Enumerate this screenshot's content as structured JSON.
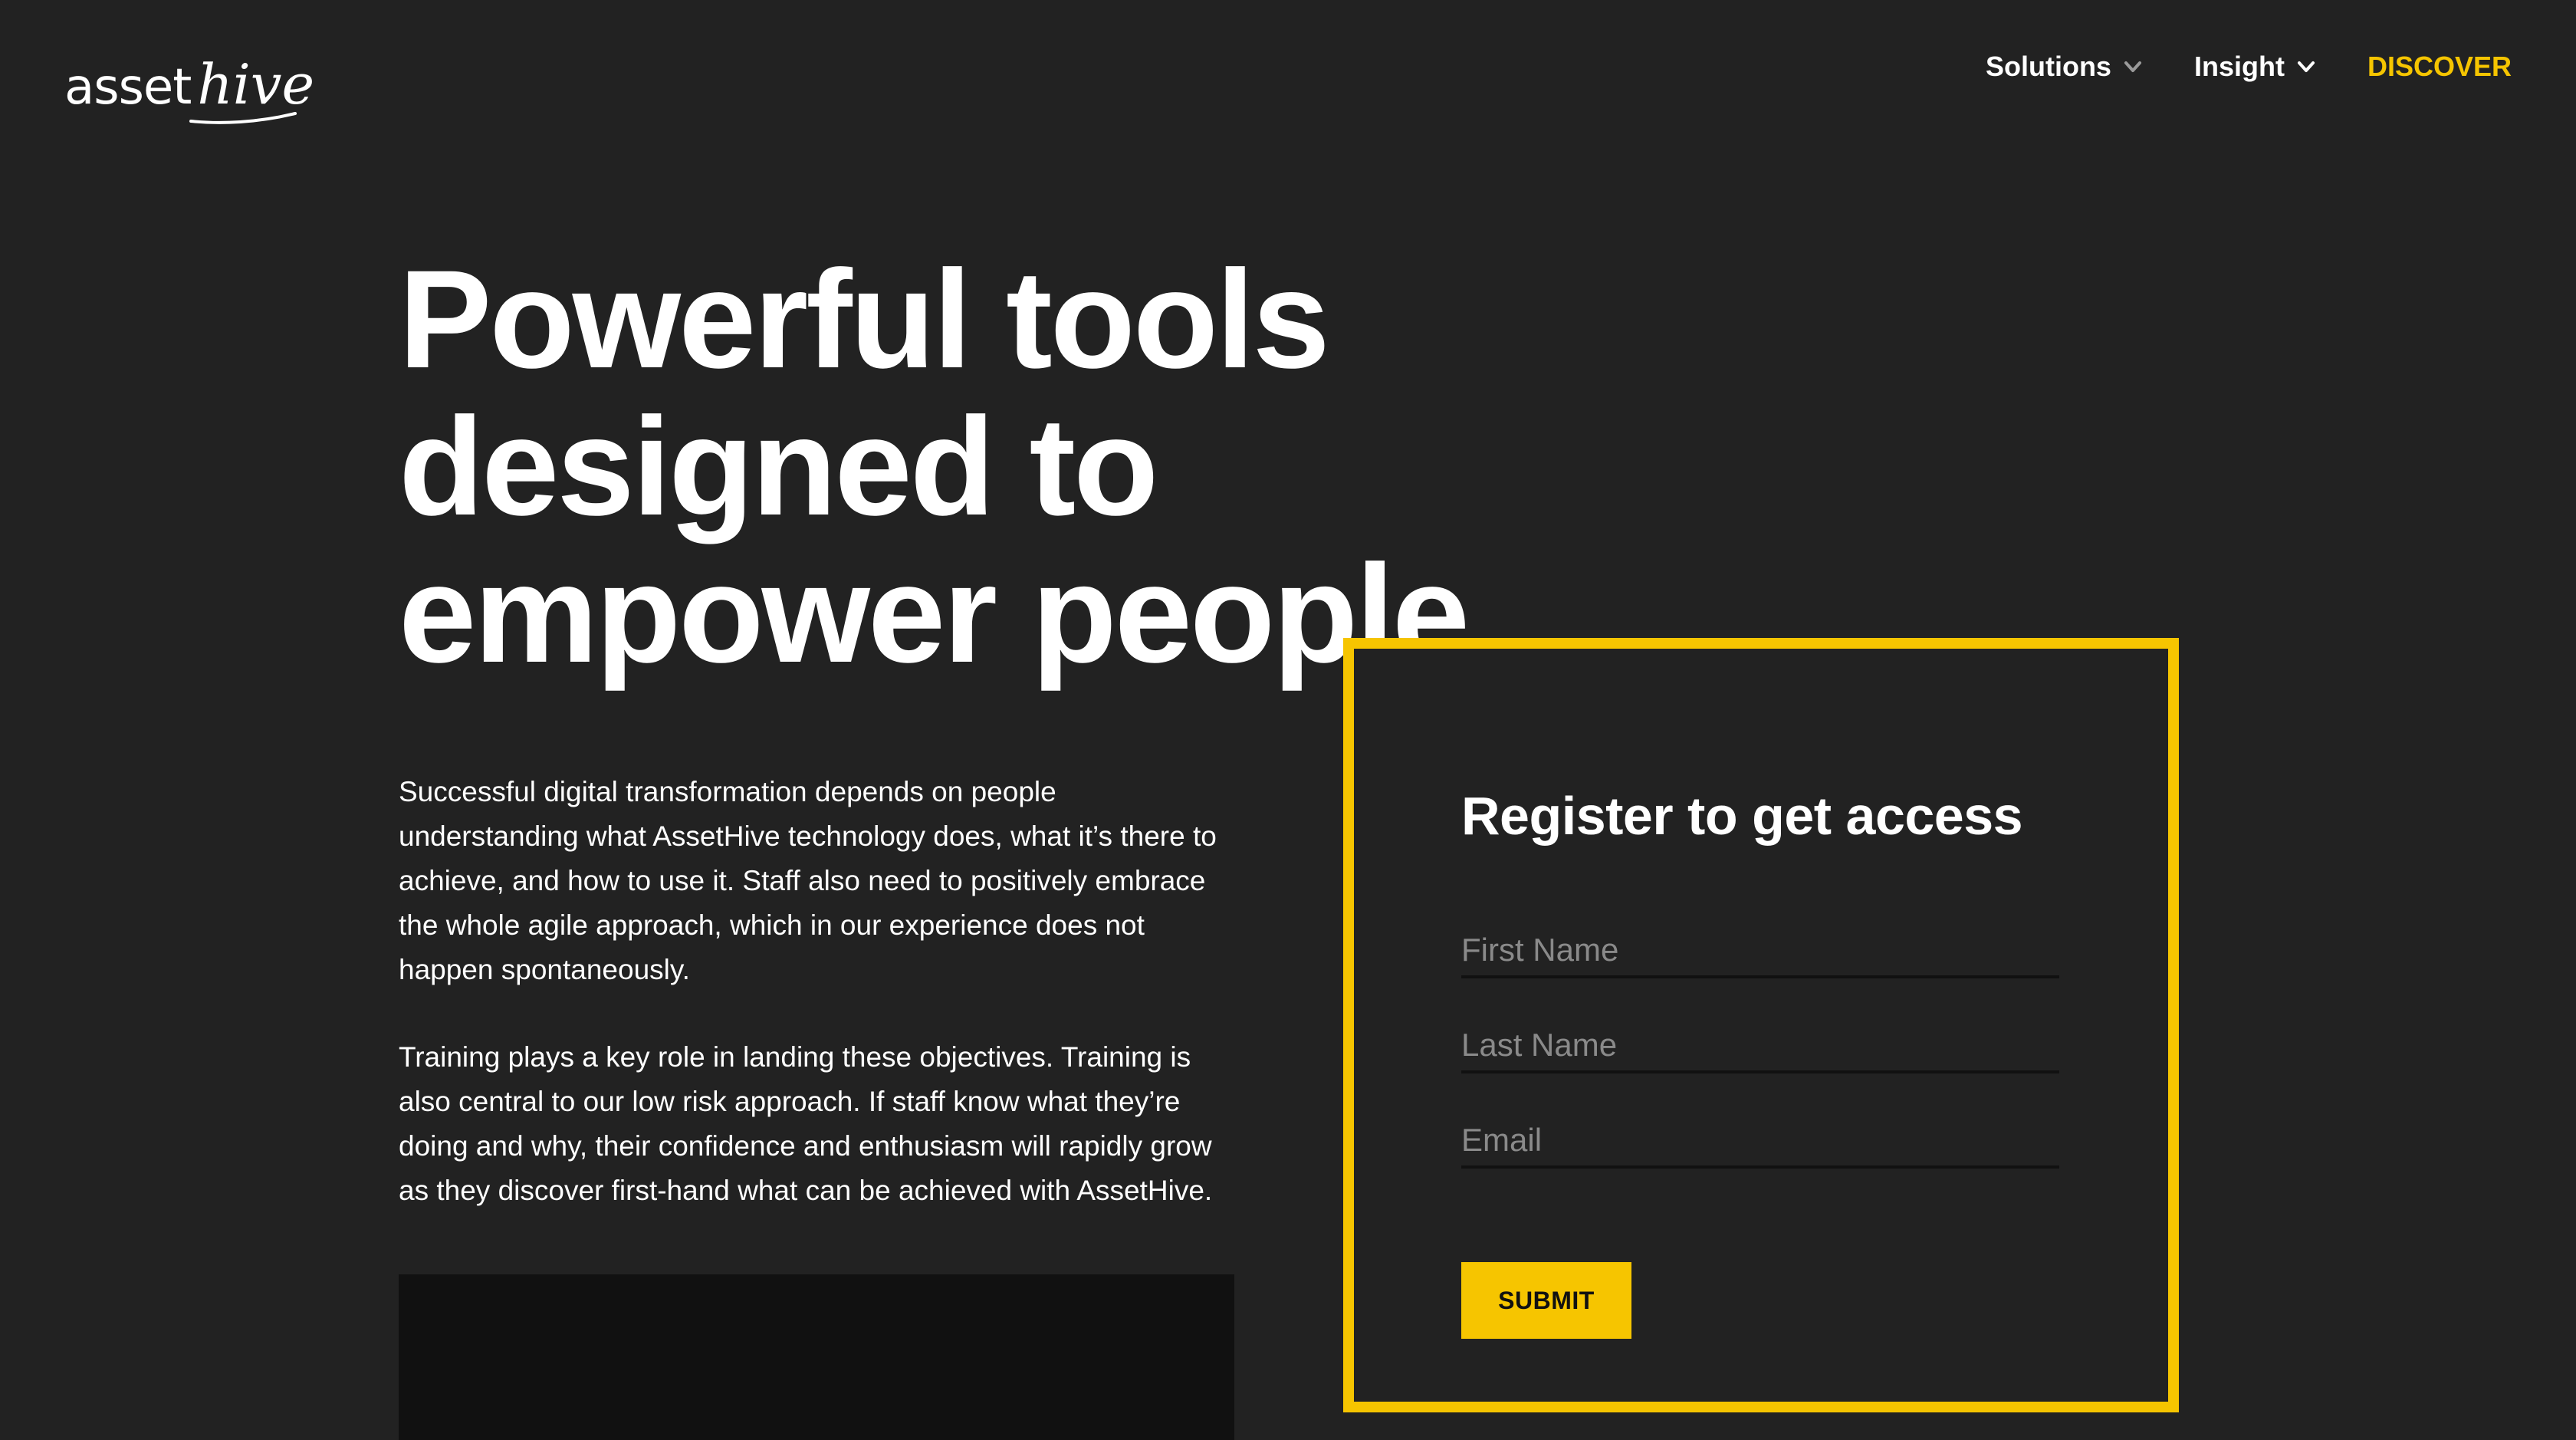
{
  "brand": {
    "logo_part1": "asset",
    "logo_part2": "hive",
    "accent_color": "#f6c500",
    "background_color": "#222222"
  },
  "nav": {
    "items": [
      {
        "label": "Solutions",
        "icon": "chevron-down-icon"
      },
      {
        "label": "Insight",
        "icon": "chevron-down-icon"
      },
      {
        "label": "DISCOVER"
      }
    ]
  },
  "hero": {
    "headline_lines": [
      "Powerful tools",
      "designed to",
      "empower people"
    ],
    "paragraphs": [
      "Successful digital transformation depends on people understanding what AssetHive technology does, what it’s there to achieve, and how to use it. Staff also need to positively embrace the whole agile approach, which in our experience does not happen spontaneously.",
      "Training plays a key role in landing these objectives. Training is also central to our low risk approach. If staff know what they’re doing and why, their confidence and enthusiasm will rapidly grow as they discover first-hand what can be achieved with AssetHive."
    ]
  },
  "register": {
    "title": "Register to get access",
    "first_name_placeholder": "First Name",
    "last_name_placeholder": "Last Name",
    "email_placeholder": "Email",
    "submit_label": "SUBMIT"
  }
}
